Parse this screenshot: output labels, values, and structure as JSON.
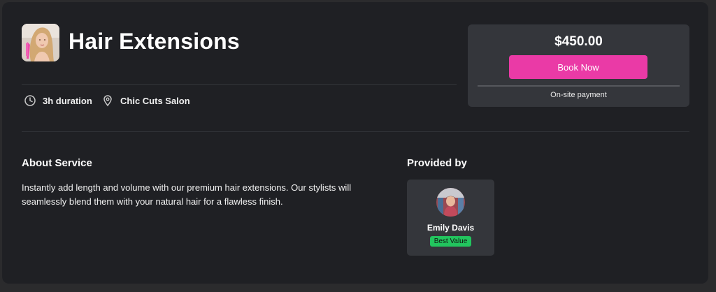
{
  "service": {
    "title": "Hair Extensions",
    "thumbnail_icon": "woman-hair-photo",
    "duration": "3h duration",
    "location": "Chic Cuts Salon"
  },
  "booking": {
    "price": "$450.00",
    "book_label": "Book Now",
    "payment_note": "On-site payment",
    "accent_color": "#ea3aa6"
  },
  "about": {
    "heading": "About Service",
    "description": "Instantly add length and volume with our premium hair extensions. Our stylists will seamlessly blend them with your natural hair for a flawless finish."
  },
  "provider": {
    "heading": "Provided by",
    "name": "Emily Davis",
    "badge": "Best Value",
    "badge_color": "#22c55e",
    "avatar_icon": "provider-avatar-photo"
  }
}
